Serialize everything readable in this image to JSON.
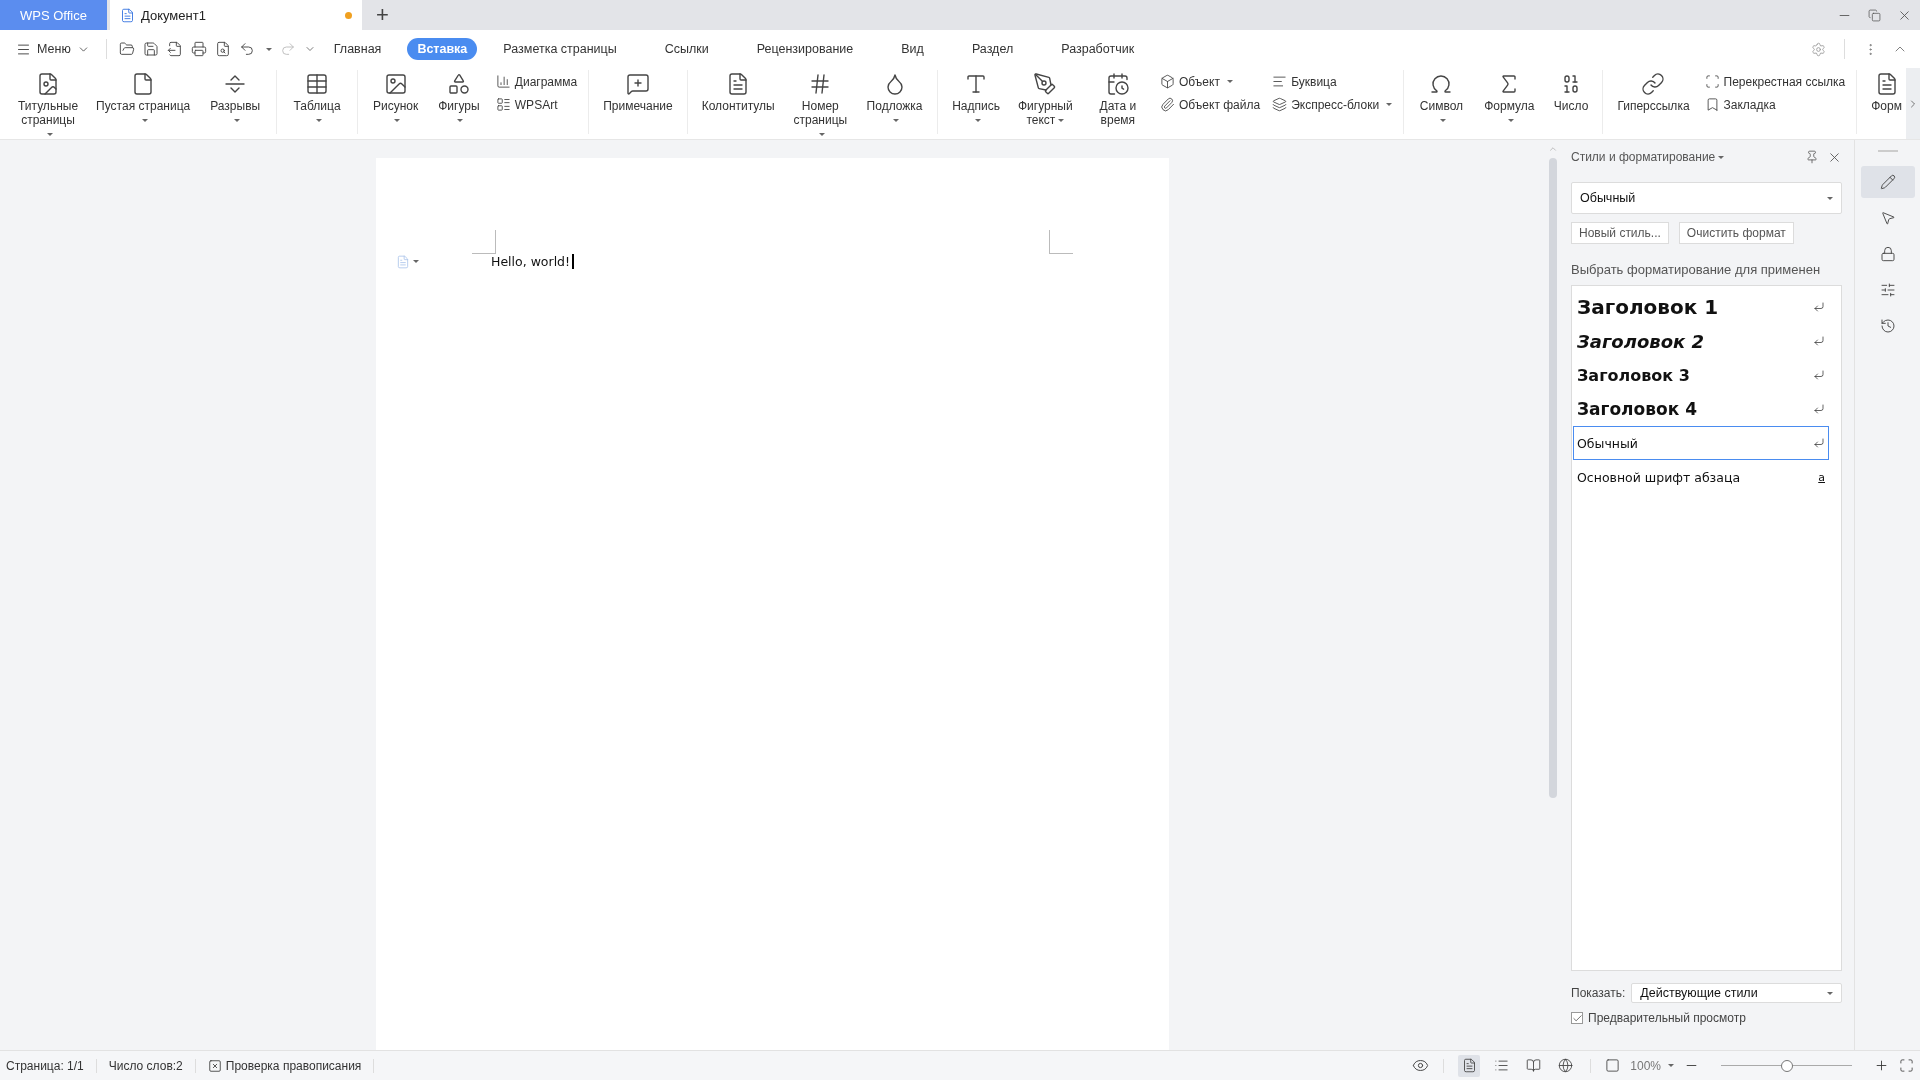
{
  "title_bar": {
    "tabs": [
      {
        "label": "WPS Office",
        "kind": "home",
        "selected": false
      },
      {
        "label": "Документ1",
        "kind": "document",
        "selected": true,
        "modified": true
      }
    ],
    "new_tab": "+"
  },
  "menu_bar": {
    "menu": "Меню",
    "tabs": [
      {
        "label": "Главная",
        "selected": false
      },
      {
        "label": "Вставка",
        "selected": true
      },
      {
        "label": "Разметка страницы",
        "selected": false
      },
      {
        "label": "Ссылки",
        "selected": false
      },
      {
        "label": "Рецензирование",
        "selected": false
      },
      {
        "label": "Вид",
        "selected": false
      },
      {
        "label": "Раздел",
        "selected": false
      },
      {
        "label": "Разработчик",
        "selected": false
      }
    ]
  },
  "ribbon": {
    "groups": [
      {
        "items": [
          {
            "kind": "large",
            "label": "Титульные\nстраницы",
            "dropdown": true
          },
          {
            "kind": "large",
            "label": "Пустая страница",
            "dropdown": true
          },
          {
            "kind": "large",
            "label": "Разрывы",
            "dropdown": true
          }
        ]
      },
      {
        "items": [
          {
            "kind": "large",
            "label": "Таблица",
            "dropdown": true
          }
        ]
      },
      {
        "items": [
          {
            "kind": "large",
            "label": "Рисунок",
            "dropdown": true
          },
          {
            "kind": "large",
            "label": "Фигуры",
            "dropdown": true
          },
          {
            "kind": "stack",
            "items": [
              {
                "label": "Диаграмма",
                "dropdown": false
              },
              {
                "label": "WPSArt",
                "dropdown": false
              }
            ]
          }
        ]
      },
      {
        "items": [
          {
            "kind": "large",
            "label": "Примечание",
            "dropdown": false
          }
        ]
      },
      {
        "items": [
          {
            "kind": "large",
            "label": "Колонтитулы",
            "dropdown": false
          },
          {
            "kind": "large",
            "label": "Номер\nстраницы",
            "dropdown": true
          },
          {
            "kind": "large",
            "label": "Подложка",
            "dropdown": true
          }
        ]
      },
      {
        "items": [
          {
            "kind": "large",
            "label": "Надпись",
            "dropdown": true
          },
          {
            "kind": "large",
            "label": "Фигурный\nтекст",
            "dropdown": true
          },
          {
            "kind": "large",
            "label": "Дата и время",
            "dropdown": false
          },
          {
            "kind": "stack",
            "items": [
              {
                "label": "Объект",
                "dropdown": true
              },
              {
                "label": "Объект файла",
                "dropdown": false
              }
            ]
          },
          {
            "kind": "stack",
            "items": [
              {
                "label": "Буквица",
                "dropdown": false
              },
              {
                "label": "Экспресс-блоки",
                "dropdown": true
              }
            ]
          }
        ]
      },
      {
        "items": [
          {
            "kind": "large",
            "label": "Символ",
            "dropdown": true
          },
          {
            "kind": "large",
            "label": "Формула",
            "dropdown": true
          },
          {
            "kind": "large",
            "label": "Число",
            "dropdown": false
          }
        ]
      },
      {
        "items": [
          {
            "kind": "large",
            "label": "Гиперссылка",
            "dropdown": false
          },
          {
            "kind": "stack",
            "items": [
              {
                "label": "Перекрестная ссылка",
                "dropdown": false
              },
              {
                "label": "Закладка",
                "dropdown": false
              }
            ]
          }
        ]
      },
      {
        "items": [
          {
            "kind": "large",
            "label": "Форм",
            "dropdown": false
          }
        ]
      }
    ]
  },
  "document": {
    "text": "Hello, world!"
  },
  "styles_panel": {
    "title": "Стили и форматирование",
    "current_style": "Обычный",
    "buttons": [
      "Новый стиль...",
      "Очистить формат"
    ],
    "prompt": "Выбрать форматирование для применен",
    "styles": [
      {
        "name": "Заголовок 1",
        "kind": "h1",
        "selected": false
      },
      {
        "name": "Заголовок 2",
        "kind": "h2",
        "selected": false
      },
      {
        "name": "Заголовок 3",
        "kind": "h3",
        "selected": false
      },
      {
        "name": "Заголовок 4",
        "kind": "h4",
        "selected": false
      },
      {
        "name": "Обычный",
        "kind": "normal",
        "selected": true
      },
      {
        "name": "Основной шрифт абзаца",
        "kind": "character",
        "symbol": "a",
        "selected": false
      }
    ],
    "show_label": "Показать:",
    "show_value": "Действующие стили",
    "preview": {
      "label": "Предварительный просмотр",
      "checked": true
    }
  },
  "side_rail": [
    {
      "selected": true
    },
    {
      "selected": false
    },
    {
      "selected": false
    },
    {
      "selected": false
    },
    {
      "selected": false
    }
  ],
  "status_bar": {
    "page": "Страница: 1/1",
    "words": "Число слов:2",
    "spellcheck": "Проверка правописания",
    "views": [
      {
        "selected": true
      },
      {
        "selected": false
      },
      {
        "selected": false
      },
      {
        "selected": false
      }
    ],
    "zoom": "100%",
    "zoom_slider": {
      "level": 0.5
    }
  }
}
